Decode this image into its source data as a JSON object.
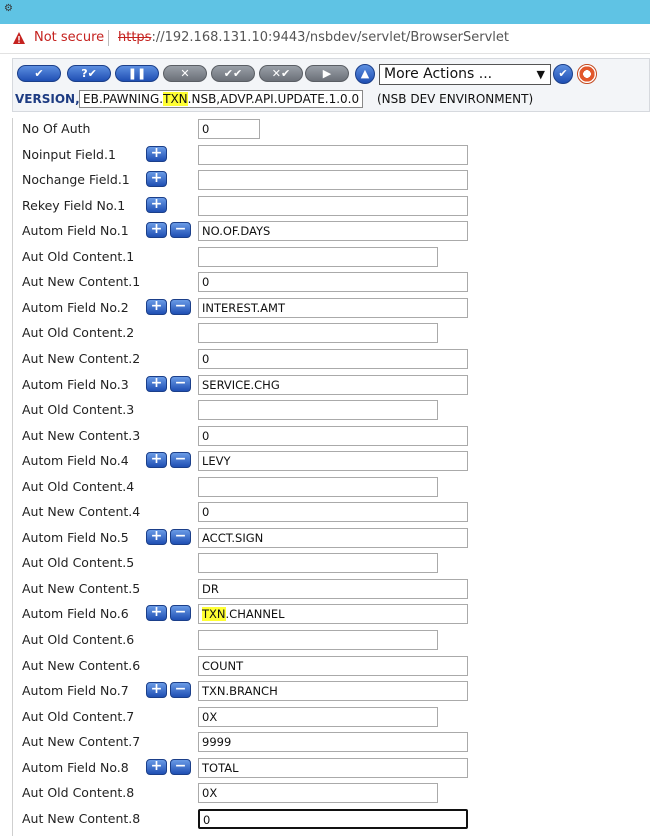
{
  "browser": {
    "security_label": "Not secure",
    "url_scheme": "https",
    "url_rest": "://192.168.131.10:9443/nsbdev/servlet/BrowserServlet"
  },
  "toolbar": {
    "buttons": [
      "✔",
      "?✔",
      "❚❚",
      "✕",
      "✔✔",
      "✕✔",
      "▶"
    ],
    "actions_select": "More Actions ...",
    "version_label": "VERSION,",
    "version_pre": "EB.PAWNING.",
    "version_hl": "TXN",
    "version_post": ".NSB,ADVP.API.UPDATE.1.0.0",
    "environment": "(NSB DEV ENVIRONMENT)"
  },
  "form": {
    "rows": [
      {
        "label": "No Of Auth",
        "value": "0"
      },
      {
        "label": "Noinput Field.1",
        "value": ""
      },
      {
        "label": "Nochange Field.1",
        "value": ""
      },
      {
        "label": "Rekey Field No.1",
        "value": ""
      },
      {
        "label": "Autom Field No.1",
        "value": "NO.OF.DAYS"
      },
      {
        "label": "Aut Old Content.1",
        "value": ""
      },
      {
        "label": "Aut New Content.1",
        "value": "0"
      },
      {
        "label": "Autom Field No.2",
        "value": "INTEREST.AMT"
      },
      {
        "label": "Aut Old Content.2",
        "value": ""
      },
      {
        "label": "Aut New Content.2",
        "value": "0"
      },
      {
        "label": "Autom Field No.3",
        "value": "SERVICE.CHG"
      },
      {
        "label": "Aut Old Content.3",
        "value": ""
      },
      {
        "label": "Aut New Content.3",
        "value": "0"
      },
      {
        "label": "Autom Field No.4",
        "value": "LEVY"
      },
      {
        "label": "Aut Old Content.4",
        "value": ""
      },
      {
        "label": "Aut New Content.4",
        "value": "0"
      },
      {
        "label": "Autom Field No.5",
        "value": "ACCT.SIGN"
      },
      {
        "label": "Aut Old Content.5",
        "value": ""
      },
      {
        "label": "Aut New Content.5",
        "value": "DR"
      },
      {
        "label": "Autom Field No.6",
        "value_hl": "TXN",
        "value": ".CHANNEL"
      },
      {
        "label": "Aut Old Content.6",
        "value": ""
      },
      {
        "label": "Aut New Content.6",
        "value": "COUNT"
      },
      {
        "label": "Autom Field No.7",
        "value": "TXN.BRANCH"
      },
      {
        "label": "Aut Old Content.7",
        "value": "0X"
      },
      {
        "label": "Aut New Content.7",
        "value": "9999"
      },
      {
        "label": "Autom Field No.8",
        "value": "TOTAL"
      },
      {
        "label": "Aut Old Content.8",
        "value": "0X"
      },
      {
        "label": "Aut New Content.8",
        "value": "0"
      }
    ]
  }
}
